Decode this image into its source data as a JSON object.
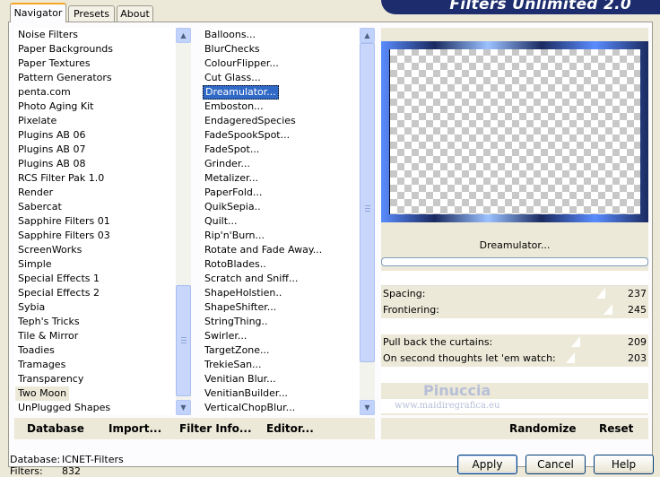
{
  "tabs": [
    {
      "label": "Navigator",
      "active": true
    },
    {
      "label": "Presets",
      "active": false
    },
    {
      "label": "About",
      "active": false
    }
  ],
  "banner_title": "Filters Unlimited 2.0",
  "categories": {
    "items": [
      "Noise Filters",
      "Paper Backgrounds",
      "Paper Textures",
      "Pattern Generators",
      "penta.com",
      "Photo Aging Kit",
      "Pixelate",
      "Plugins AB 06",
      "Plugins AB 07",
      "Plugins AB 08",
      "RCS Filter Pak 1.0",
      "Render",
      "Sabercat",
      "Sapphire Filters 01",
      "Sapphire Filters 03",
      "ScreenWorks",
      "Simple",
      "Special Effects 1",
      "Special Effects 2",
      "Sybia",
      "Teph's Tricks",
      "Tile & Mirror",
      "Toadies",
      "Tramages",
      "Transparency",
      "Two Moon",
      "UnPlugged Shapes"
    ],
    "current": "Two Moon"
  },
  "filters": {
    "items": [
      "Balloons...",
      "BlurChecks",
      "ColourFlipper...",
      "Cut Glass...",
      "Dreamulator...",
      "Emboston...",
      "EndageredSpecies",
      "FadeSpookSpot...",
      "FadeSpot...",
      "Grinder...",
      "Metalizer...",
      "PaperFold...",
      "QuikSepia..",
      "Quilt...",
      "Rip'n'Burn...",
      "Rotate and Fade Away...",
      "RotoBlades..",
      "Scratch and Sniff...",
      "ShapeHolstien..",
      "ShapeShifter...",
      "StringThing..",
      "Swirler...",
      "TargetZone...",
      "TrekieSan...",
      "Venitian Blur...",
      "VenitianBuilder...",
      "VerticalChopBlur..."
    ],
    "selected": "Dreamulator..."
  },
  "preview_filter_name": "Dreamulator...",
  "sliders": [
    {
      "label": "Spacing:",
      "value": "237"
    },
    {
      "label": "Frontiering:",
      "value": "245"
    },
    {
      "label": "Pull back the curtains:",
      "value": "209"
    },
    {
      "label": "On second thoughts let 'em watch:",
      "value": "203"
    }
  ],
  "slider_levels": [
    0.93,
    0.96,
    0.82,
    0.8
  ],
  "watermark": {
    "name": "Pinuccia",
    "url": "www.maidiregrafica.eu"
  },
  "bottom_links": {
    "database": "Database",
    "import": "Import...",
    "filter_info": "Filter Info...",
    "editor": "Editor...",
    "randomize": "Randomize",
    "reset": "Reset"
  },
  "status": {
    "database_label": "Database:",
    "database_value": "ICNET-Filters",
    "filters_label": "Filters:",
    "filters_value": "832"
  },
  "buttons": {
    "apply": "Apply",
    "cancel": "Cancel",
    "help": "Help"
  },
  "colors": {
    "selection": "#3169c6",
    "banner": "#1c2c6c",
    "accent_tab": "#f6a623"
  }
}
